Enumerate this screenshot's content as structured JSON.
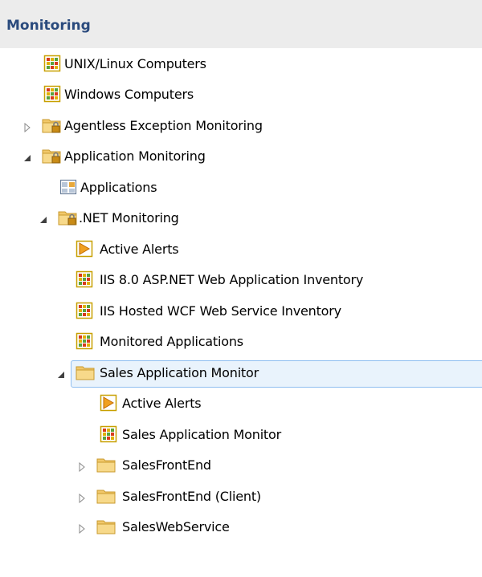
{
  "header": {
    "title": "Monitoring"
  },
  "tree": [
    {
      "label": "UNIX/Linux Computers",
      "icon": "state-view-icon",
      "level": 0,
      "expander": "none",
      "selected": false
    },
    {
      "label": "Windows Computers",
      "icon": "state-view-icon",
      "level": 0,
      "expander": "none",
      "selected": false
    },
    {
      "label": "Agentless Exception Monitoring",
      "icon": "locked-folder-icon",
      "level": 0,
      "expander": "collapsed",
      "selected": false
    },
    {
      "label": "Application Monitoring",
      "icon": "locked-folder-icon",
      "level": 0,
      "expander": "expanded",
      "selected": false
    },
    {
      "label": "Applications",
      "icon": "dashboard-view-icon",
      "level": 1,
      "expander": "none",
      "selected": false
    },
    {
      "label": ".NET Monitoring",
      "icon": "locked-folder-icon",
      "level": 1,
      "expander": "expanded",
      "selected": false
    },
    {
      "label": "Active Alerts",
      "icon": "alert-view-icon",
      "level": 2,
      "expander": "none",
      "selected": false
    },
    {
      "label": "IIS 8.0 ASP.NET Web Application Inventory",
      "icon": "state-view-icon",
      "level": 2,
      "expander": "none",
      "selected": false
    },
    {
      "label": "IIS Hosted WCF Web Service Inventory",
      "icon": "state-view-icon",
      "level": 2,
      "expander": "none",
      "selected": false
    },
    {
      "label": "Monitored Applications",
      "icon": "state-view-icon",
      "level": 2,
      "expander": "none",
      "selected": false
    },
    {
      "label": "Sales Application Monitor",
      "icon": "folder-icon",
      "level": 2,
      "expander": "expanded",
      "selected": true
    },
    {
      "label": "Active Alerts",
      "icon": "alert-view-icon",
      "level": 3,
      "expander": "none",
      "selected": false
    },
    {
      "label": "Sales Application Monitor",
      "icon": "state-view-icon",
      "level": 3,
      "expander": "none",
      "selected": false
    },
    {
      "label": "SalesFrontEnd",
      "icon": "folder-icon",
      "level": 3,
      "expander": "collapsed",
      "selected": false
    },
    {
      "label": "SalesFrontEnd (Client)",
      "icon": "folder-icon",
      "level": 3,
      "expander": "collapsed",
      "selected": false
    },
    {
      "label": "SalesWebService",
      "icon": "folder-icon",
      "level": 3,
      "expander": "collapsed",
      "selected": false
    }
  ]
}
